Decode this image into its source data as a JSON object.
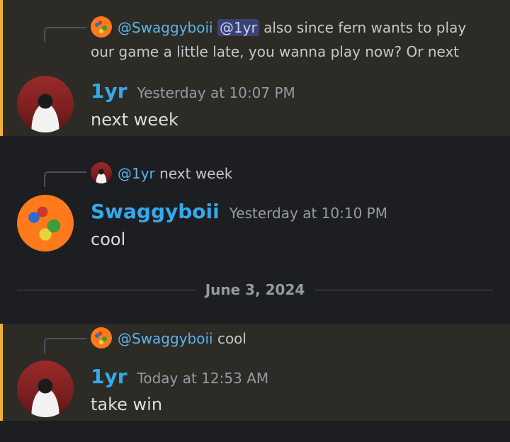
{
  "messages": [
    {
      "highlighted": true,
      "reply": {
        "name": "@Swaggyboii",
        "mention": "@1yr",
        "text": "also since fern wants to play our game a little late, you wanna play now? Or next"
      },
      "author": "1yr",
      "timestamp": "Yesterday at 10:07 PM",
      "content": "next week"
    },
    {
      "highlighted": false,
      "reply": {
        "name": "@1yr",
        "text": "next week"
      },
      "author": "Swaggyboii",
      "timestamp": "Yesterday at 10:10 PM",
      "content": "cool"
    },
    {
      "highlighted": true,
      "reply": {
        "name": "@Swaggyboii",
        "text": "cool"
      },
      "author": "1yr",
      "timestamp": "Today at 12:53 AM",
      "content": "take win"
    }
  ],
  "date_divider": "June 3, 2024",
  "colors": {
    "mention_bar": "#f0b232",
    "username": "#34a9eb",
    "reply_name": "#5eb4e9",
    "background": "#1d1e22"
  }
}
